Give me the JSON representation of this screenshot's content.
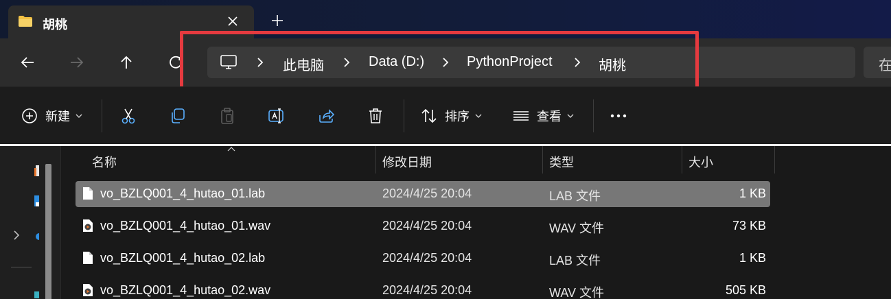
{
  "tab": {
    "title": "胡桃"
  },
  "breadcrumbs": [
    "此电脑",
    "Data (D:)",
    "PythonProject",
    "胡桃"
  ],
  "search": {
    "text": "在"
  },
  "toolbar": {
    "new_label": "新建",
    "sort_label": "排序",
    "view_label": "查看"
  },
  "columns": {
    "name": "名称",
    "date": "修改日期",
    "type": "类型",
    "size": "大小"
  },
  "files": [
    {
      "name": "vo_BZLQ001_4_hutao_01.lab",
      "date": "2024/4/25 20:04",
      "type": "LAB 文件",
      "size": "1 KB",
      "icon": "file-icon"
    },
    {
      "name": "vo_BZLQ001_4_hutao_01.wav",
      "date": "2024/4/25 20:04",
      "type": "WAV 文件",
      "size": "73 KB",
      "icon": "audio-file-icon"
    },
    {
      "name": "vo_BZLQ001_4_hutao_02.lab",
      "date": "2024/4/25 20:04",
      "type": "LAB 文件",
      "size": "1 KB",
      "icon": "file-icon"
    },
    {
      "name": "vo_BZLQ001_4_hutao_02.wav",
      "date": "2024/4/25 20:04",
      "type": "WAV 文件",
      "size": "505 KB",
      "icon": "audio-file-icon"
    }
  ],
  "colors": {
    "highlight_box": "#e53a3f",
    "selected_row": "#777777",
    "folder": "#f3c244"
  }
}
